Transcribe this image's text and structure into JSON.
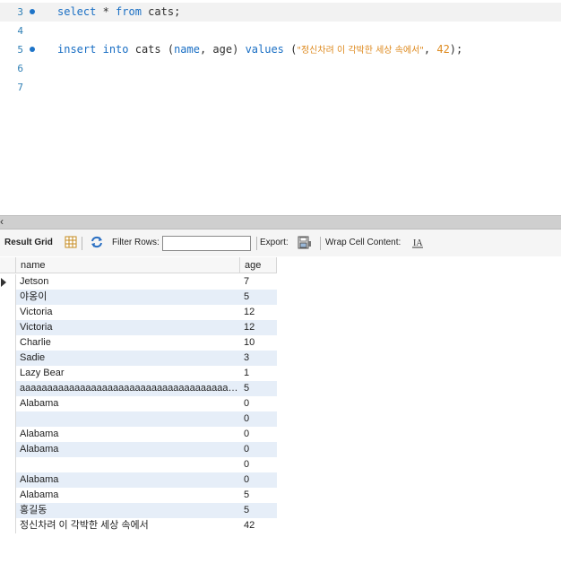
{
  "editor": {
    "lines": [
      {
        "no": "3",
        "marker": true,
        "parts": [
          {
            "t": "select",
            "c": "kw"
          },
          {
            "t": " * ",
            "c": ""
          },
          {
            "t": "from",
            "c": "kw"
          },
          {
            "t": " cats;",
            "c": ""
          }
        ]
      },
      {
        "no": "4",
        "marker": false,
        "parts": []
      },
      {
        "no": "5",
        "marker": true,
        "parts": [
          {
            "t": "insert",
            "c": "kw"
          },
          {
            "t": " ",
            "c": ""
          },
          {
            "t": "into",
            "c": "kw"
          },
          {
            "t": " cats (",
            "c": ""
          },
          {
            "t": "name",
            "c": "kw"
          },
          {
            "t": ", age) ",
            "c": ""
          },
          {
            "t": "values",
            "c": "kw"
          },
          {
            "t": " (",
            "c": ""
          },
          {
            "t": "\"정신차려 이 각박한 세상 속에서\"",
            "c": "str"
          },
          {
            "t": ", ",
            "c": ""
          },
          {
            "t": "42",
            "c": "num"
          },
          {
            "t": ");",
            "c": ""
          }
        ]
      },
      {
        "no": "6",
        "marker": false,
        "parts": []
      },
      {
        "no": "7",
        "marker": false,
        "parts": []
      }
    ]
  },
  "toolbar": {
    "result_grid": "Result Grid",
    "filter_rows": "Filter Rows:",
    "filter_value": "",
    "export": "Export:",
    "wrap_cell": "Wrap Cell Content:"
  },
  "grid": {
    "columns": [
      "name",
      "age"
    ],
    "rows": [
      {
        "name": "Jetson",
        "age": "7"
      },
      {
        "name": "야옹이",
        "age": "5"
      },
      {
        "name": "Victoria",
        "age": "12"
      },
      {
        "name": "Victoria",
        "age": "12"
      },
      {
        "name": "Charlie",
        "age": "10"
      },
      {
        "name": "Sadie",
        "age": "3"
      },
      {
        "name": "Lazy Bear",
        "age": "1"
      },
      {
        "name": "aaaaaaaaaaaaaaaaaaaaaaaaaaaaaaaaaaaaaaaaaaaaaaaaaaaaaaaaaaaaaaaaaaaaaaaaaaaaaaaaaaaaaaaaaaaaaaaaaaaaaaaaaaaaaaaaaaaa",
        "age": "5"
      },
      {
        "name": "Alabama",
        "age": "0"
      },
      {
        "name": "",
        "age": "0"
      },
      {
        "name": "Alabama",
        "age": "0"
      },
      {
        "name": "Alabama",
        "age": "0"
      },
      {
        "name": "",
        "age": "0"
      },
      {
        "name": "Alabama",
        "age": "0"
      },
      {
        "name": "Alabama",
        "age": "5"
      },
      {
        "name": "홍길동",
        "age": "5"
      },
      {
        "name": "정신차려 이 각박한 세상 속에서",
        "age": "42"
      }
    ]
  }
}
